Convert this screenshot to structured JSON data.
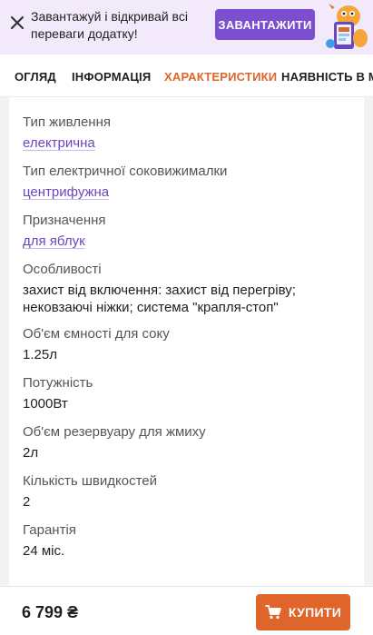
{
  "promo": {
    "text": "Завантажуй і відкривай всі переваги додатку!",
    "button_label": "ЗАВАНТАЖИТИ"
  },
  "tabs": [
    {
      "label": "ОГЛЯД"
    },
    {
      "label": "ІНФОРМАЦІЯ"
    },
    {
      "label": "ХАРАКТЕРИСТИКИ",
      "active": true
    },
    {
      "label": "НАЯВНІСТЬ В МАГ"
    }
  ],
  "specs": [
    {
      "label": "Тип живлення",
      "value": "електрична"
    },
    {
      "label": "Тип електричної соковижималки",
      "value": "центрифужна"
    },
    {
      "label": "Призначення",
      "value": "для яблук"
    },
    {
      "label": "Особливості",
      "value": "захист від включення: захист від перегріву; нековзаючі ніжки; система \"крапля-стоп\""
    },
    {
      "label": "Об'єм ємності для соку",
      "value": "1.25л"
    },
    {
      "label": "Потужність",
      "value": "1000Вт"
    },
    {
      "label": "Об'єм резервуару для жмиху",
      "value": "2л"
    },
    {
      "label": "Кількість швидкостей",
      "value": "2"
    },
    {
      "label": "Гарантія",
      "value": "24 міс."
    }
  ],
  "bottom": {
    "price": "6 799 ₴",
    "buy_label": "КУПИТИ"
  },
  "colors": {
    "accent": "#e0652a",
    "purple": "#7b4fd0",
    "link": "#6b46c1",
    "promo_bg": "#f2e9fb"
  }
}
